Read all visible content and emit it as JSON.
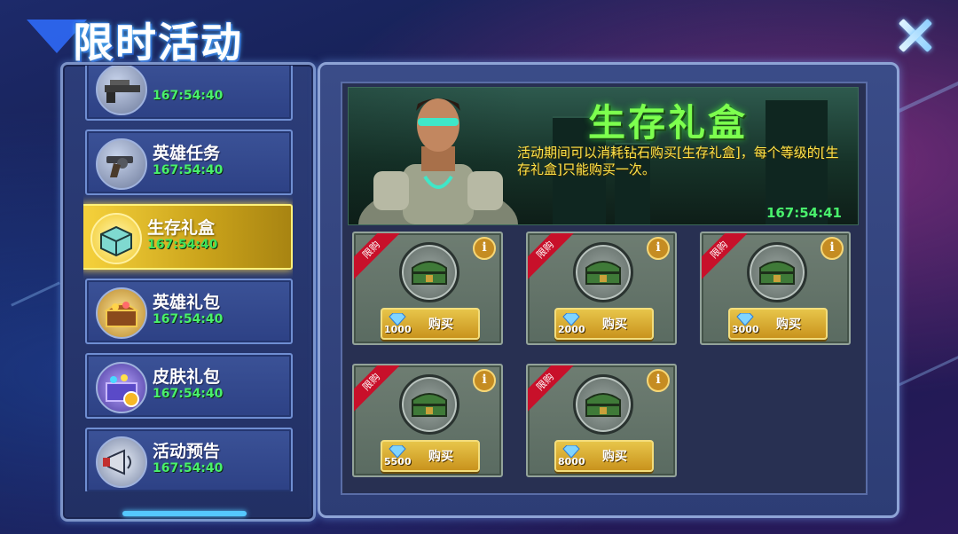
{
  "header": {
    "title": "限时活动",
    "close_icon": "close-x-icon"
  },
  "menu": {
    "items": [
      {
        "label": "",
        "timer": "167:54:40",
        "icon": "sniper-rifle-icon",
        "active": false,
        "partial": true
      },
      {
        "label": "英雄任务",
        "timer": "167:54:40",
        "icon": "revolver-icon",
        "active": false
      },
      {
        "label": "生存礼盒",
        "timer": "167:54:40",
        "icon": "teal-box-icon",
        "active": true
      },
      {
        "label": "英雄礼包",
        "timer": "167:54:40",
        "icon": "treasure-chest-icon",
        "active": false
      },
      {
        "label": "皮肤礼包",
        "timer": "167:54:40",
        "icon": "gift-box-icon",
        "active": false
      },
      {
        "label": "活动预告",
        "timer": "167:54:40",
        "icon": "megaphone-icon",
        "active": false
      }
    ]
  },
  "banner": {
    "title": "生存礼盒",
    "description": "活动期间可以消耗钻石购买[生存礼盒]，每个等级的[生存礼盒]只能购买一次。",
    "timer": "167:54:41"
  },
  "cards": [
    {
      "ribbon": "限购",
      "price": "1000",
      "button": "购买",
      "icon": "green-ammo-crate-icon"
    },
    {
      "ribbon": "限购",
      "price": "2000",
      "button": "购买",
      "icon": "green-ammo-crate-icon"
    },
    {
      "ribbon": "限购",
      "price": "3000",
      "button": "购买",
      "icon": "green-ammo-crate-icon"
    },
    {
      "ribbon": "限购",
      "price": "5500",
      "button": "购买",
      "icon": "green-ammo-crate-icon"
    },
    {
      "ribbon": "限购",
      "price": "8000",
      "button": "购买",
      "icon": "green-ammo-crate-icon"
    }
  ],
  "colors": {
    "timer_green": "#49f06c",
    "banner_title": "#7dff4e",
    "desc_yellow": "#ffe34a",
    "active_gold": "#f6d23c"
  }
}
